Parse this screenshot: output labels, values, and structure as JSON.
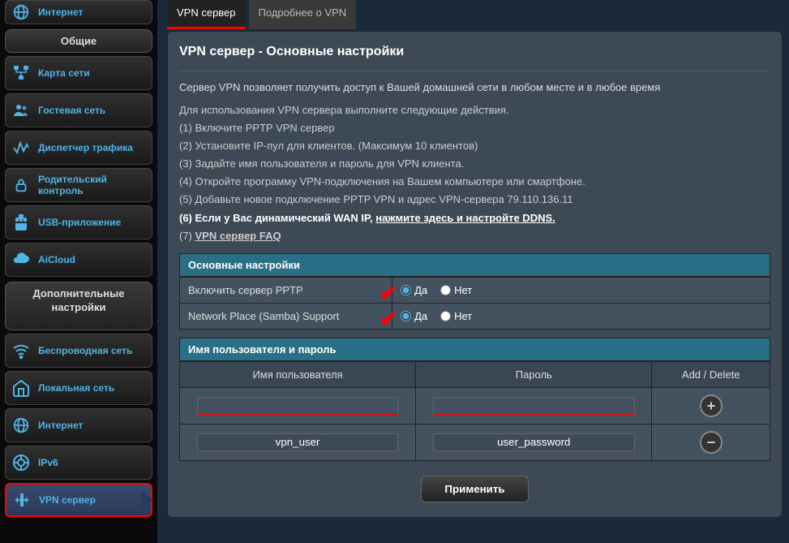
{
  "sidebar": {
    "top_item": "Интернет",
    "section_general": "Общие",
    "items_general": [
      {
        "label": "Карта сети",
        "icon": "network-map-icon"
      },
      {
        "label": "Гостевая сеть",
        "icon": "guest-network-icon"
      },
      {
        "label": "Диспетчер трафика",
        "icon": "traffic-manager-icon"
      },
      {
        "label": "Родительский контроль",
        "icon": "parental-control-icon"
      },
      {
        "label": "USB-приложение",
        "icon": "usb-app-icon"
      },
      {
        "label": "AiCloud",
        "icon": "aicloud-icon"
      }
    ],
    "section_advanced": "Дополнительные настройки",
    "items_advanced": [
      {
        "label": "Беспроводная сеть",
        "icon": "wifi-icon"
      },
      {
        "label": "Локальная сеть",
        "icon": "lan-icon"
      },
      {
        "label": "Интернет",
        "icon": "internet-icon"
      },
      {
        "label": "IPv6",
        "icon": "ipv6-icon"
      },
      {
        "label": "VPN сервер",
        "icon": "vpn-icon"
      }
    ]
  },
  "tabs": {
    "active": "VPN сервер",
    "other": "Подробнее о VPN"
  },
  "page": {
    "title": "VPN сервер - Основные настройки",
    "desc": "Сервер VPN позволяет получить доступ к Вашей домашней сети в любом месте и в любое время",
    "intro": "Для использования VPN сервера выполните следующие действия.",
    "steps": [
      "(1) Включите PPTP VPN сервер",
      "(2) Установите IP-пул для клиентов. (Максимум 10 клиентов)",
      "(3) Задайте имя пользователя и пароль для VPN клиента.",
      "(4) Откройте программу VPN-подключения на Вашем компьютере или смартфоне.",
      "(5) Добавьте новое подключение PPTP VPN и адрес VPN-сервера 79.110.136.11"
    ],
    "step6_a": "(6) Если у Вас динамический WAN IP, ",
    "step6_link": "нажмите здесь и настройте DDNS.",
    "step7": "(7) ",
    "step7_link": "VPN сервер FAQ"
  },
  "basic": {
    "header": "Основные настройки",
    "row1": "Включить сервер PPTP",
    "row2": "Network Place (Samba) Support",
    "yes": "Да",
    "no": "Нет"
  },
  "userpass": {
    "header": "Имя пользователя и пароль",
    "col_user": "Имя пользователя",
    "col_pass": "Пароль",
    "col_act": "Add / Delete",
    "sample_user": "vpn_user",
    "sample_pass": "user_password"
  },
  "apply": "Применить"
}
